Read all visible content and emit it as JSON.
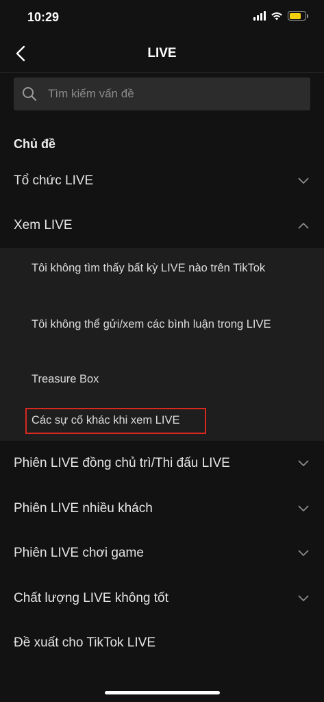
{
  "status": {
    "time": "10:29"
  },
  "nav": {
    "title": "LIVE"
  },
  "search": {
    "placeholder": "Tìm kiếm vấn đề"
  },
  "section_title": "Chủ đề",
  "topics": [
    {
      "label": "Tổ chức LIVE",
      "expanded": false
    },
    {
      "label": "Xem LIVE",
      "expanded": true
    },
    {
      "label": "Phiên LIVE đồng chủ trì/Thi đấu LIVE",
      "expanded": false
    },
    {
      "label": "Phiên LIVE nhiều khách",
      "expanded": false
    },
    {
      "label": "Phiên LIVE chơi game",
      "expanded": false
    },
    {
      "label": "Chất lượng LIVE không tốt",
      "expanded": false
    },
    {
      "label": "Đề xuất cho TikTok LIVE",
      "expanded": false
    }
  ],
  "subtopics": [
    {
      "label": "Tôi không tìm thấy bất kỳ LIVE nào trên TikTok"
    },
    {
      "label": "Tôi không thể gửi/xem các bình luận trong LIVE"
    },
    {
      "label": "Treasure Box"
    },
    {
      "label": "Các sự cố khác khi xem LIVE",
      "highlighted": true
    }
  ],
  "colors": {
    "background": "#121212",
    "panel": "#1e1e1e",
    "highlight": "#d8281f",
    "battery": "#f4d10c"
  }
}
